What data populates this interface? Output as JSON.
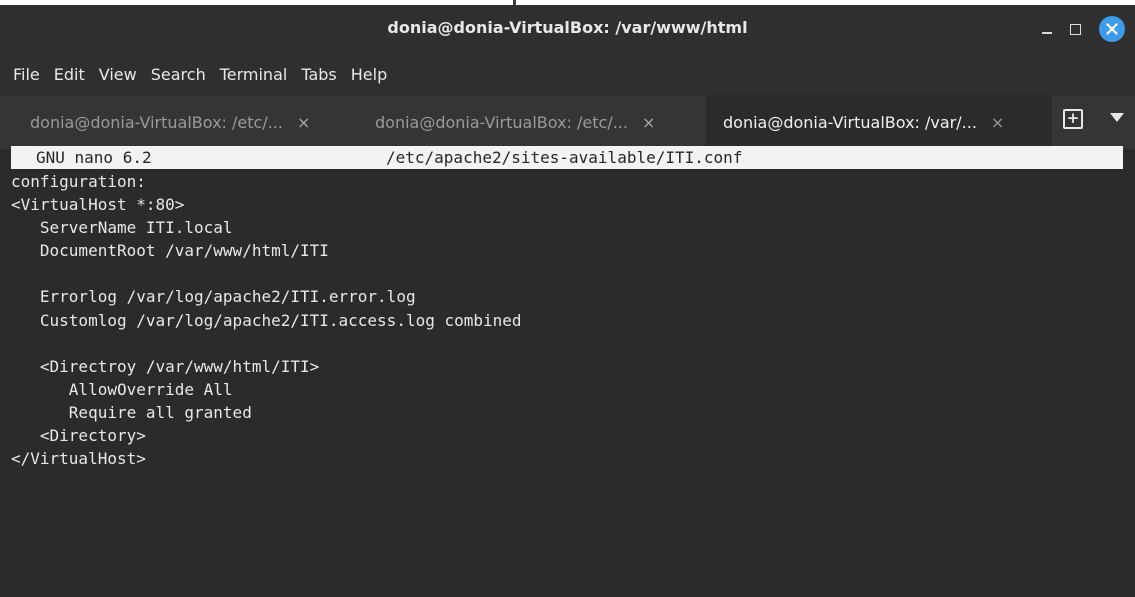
{
  "window": {
    "title": "donia@donia-VirtualBox: /var/www/html",
    "colors": {
      "background": "#2b2b2b",
      "close_button": "#3d9be9",
      "text": "#e8e8e8"
    }
  },
  "menu": {
    "items": [
      "File",
      "Edit",
      "View",
      "Search",
      "Terminal",
      "Tabs",
      "Help"
    ]
  },
  "tabs": [
    {
      "label": "donia@donia-VirtualBox: /etc/...",
      "close": "×",
      "active": false
    },
    {
      "label": "donia@donia-VirtualBox: /etc/...",
      "close": "×",
      "active": false
    },
    {
      "label": "donia@donia-VirtualBox: /var/...",
      "close": "×",
      "active": true
    }
  ],
  "tab_actions": {
    "new_tab": "+"
  },
  "nano": {
    "version": "GNU nano 6.2",
    "filename": "/etc/apache2/sites-available/ITI.conf"
  },
  "content": {
    "lines": [
      "configuration:",
      "<VirtualHost *:80>",
      "   ServerName ITI.local",
      "   DocumentRoot /var/www/html/ITI",
      "",
      "   Errorlog /var/log/apache2/ITI.error.log",
      "   Customlog /var/log/apache2/ITI.access.log combined",
      "",
      "   <Directroy /var/www/html/ITI>",
      "      AllowOverride All",
      "      Require all granted",
      "   <Directory>",
      "</VirtualHost>"
    ]
  }
}
